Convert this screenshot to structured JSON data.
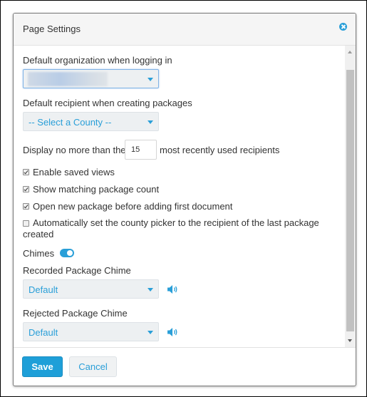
{
  "dialog": {
    "title": "Page Settings",
    "close_icon": "close-circle-icon"
  },
  "fields": {
    "default_org": {
      "label": "Default organization when logging in",
      "value": "[redacted]"
    },
    "default_recipient": {
      "label": "Default recipient when creating packages",
      "value": "-- Select a County --"
    },
    "recent_limit": {
      "prefix": "Display no more than the",
      "value": "15",
      "suffix": "most recently used recipients"
    },
    "checkboxes": [
      {
        "label": "Enable saved views",
        "checked": true
      },
      {
        "label": "Show matching package count",
        "checked": true
      },
      {
        "label": "Open new package before adding first document",
        "checked": true
      },
      {
        "label": "Automatically set the county picker to the recipient of the last package created",
        "checked": false
      }
    ],
    "chimes": {
      "label": "Chimes",
      "enabled": true
    },
    "recorded_chime": {
      "label": "Recorded Package Chime",
      "value": "Default",
      "icon": "speaker-icon"
    },
    "rejected_chime": {
      "label": "Rejected Package Chime",
      "value": "Default",
      "icon": "speaker-icon"
    }
  },
  "footer": {
    "save_label": "Save",
    "cancel_label": "Cancel"
  },
  "colors": {
    "accent": "#1e9fd8",
    "select_bg": "#edf0f2"
  }
}
